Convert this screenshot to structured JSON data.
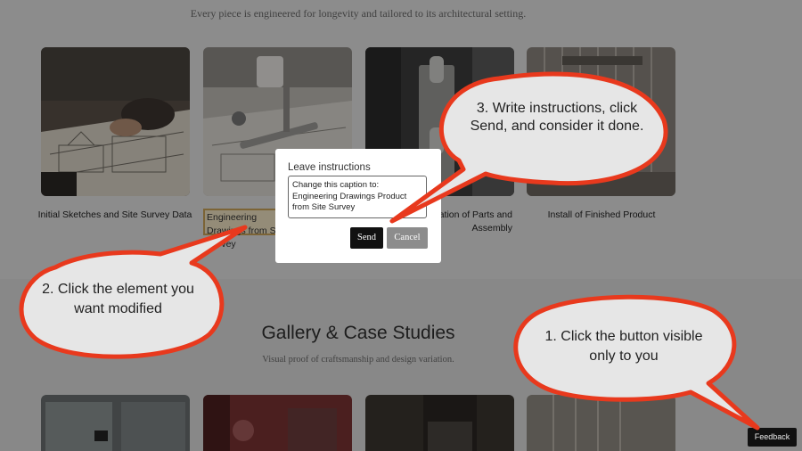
{
  "page": {
    "tagline": "Every piece is engineered for longevity and tailored to its architectural setting.",
    "process_cards": [
      {
        "caption": "Initial Sketches and Site Survey Data",
        "image": "sketching-blueprints-image"
      },
      {
        "caption": "Engineering Drawings from Site Survey",
        "image": "engineering-drawings-image"
      },
      {
        "caption": "Fabrication of Parts and Assembly",
        "image": "door-hardware-image"
      },
      {
        "caption": "Install of Finished Product",
        "image": "installed-partition-image"
      }
    ],
    "gallery": {
      "title": "Gallery & Case Studies",
      "subtitle": "Visual proof of craftsmanship and design variation."
    }
  },
  "modal": {
    "title": "Leave instructions",
    "text": "Change this caption to: Engineering Drawings Product from Site Survey",
    "send_label": "Send",
    "cancel_label": "Cancel"
  },
  "feedback_button": {
    "label": "Feedback"
  },
  "callouts": {
    "step1": "1. Click the button visible only to you",
    "step2": "2. Click the element you want modified",
    "step3": "3. Write instructions, click Send, and consider it done."
  },
  "colors": {
    "callout_border": "#e8391d",
    "callout_fill": "#e6e6e6",
    "selected_outline": "#c8a257"
  }
}
